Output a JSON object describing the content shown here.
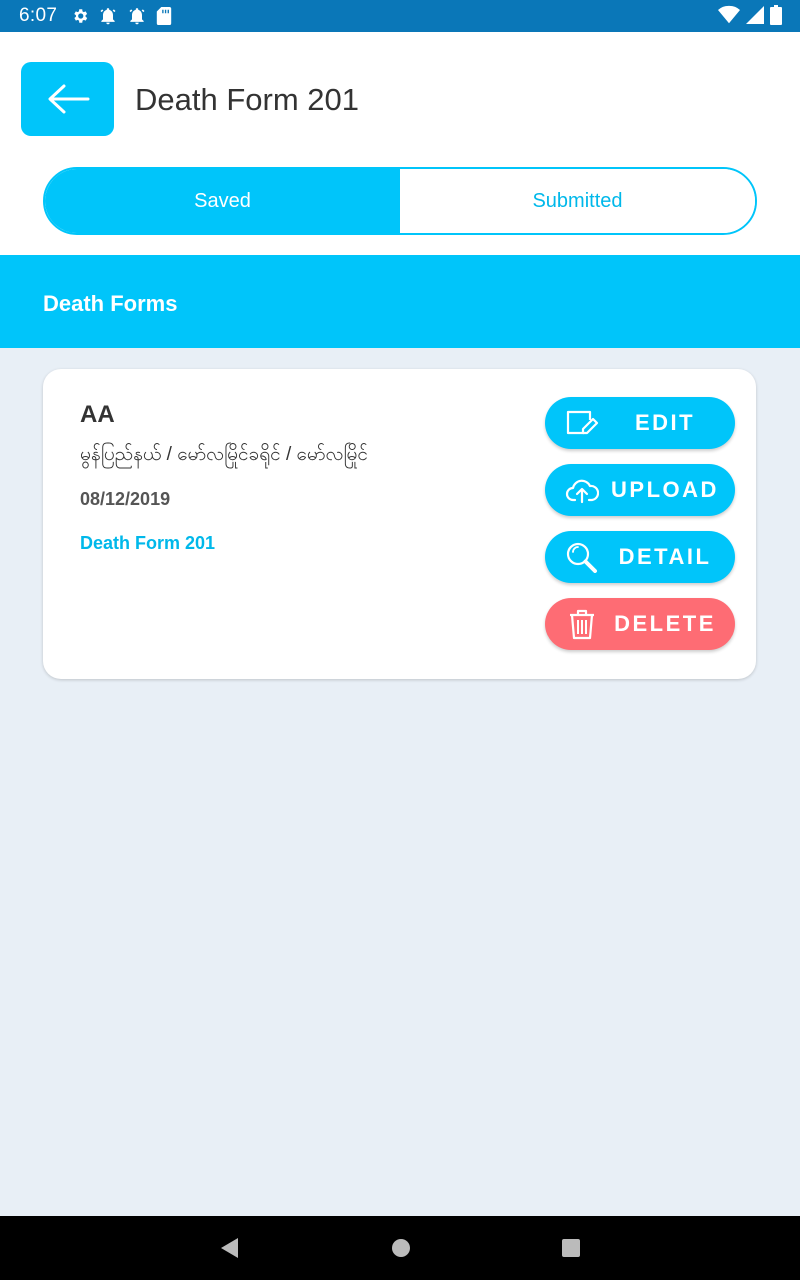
{
  "status_bar": {
    "time": "6:07",
    "left_icons": [
      "gear-icon",
      "alarm-icon",
      "alarm-icon",
      "sd-card-icon"
    ],
    "right_icons": [
      "wifi-icon",
      "signal-icon",
      "battery-icon"
    ]
  },
  "app_bar": {
    "back_icon": "arrow-left-icon",
    "title": "Death Form 201"
  },
  "tabs": [
    {
      "label": "Saved",
      "active": true
    },
    {
      "label": "Submitted",
      "active": false
    }
  ],
  "section": {
    "title": "Death Forms"
  },
  "records": [
    {
      "name": "AA",
      "address": "မွန်ပြည်နယ် / မော်လမြိုင်ခရိုင် / မော်လမြိုင်",
      "date": "08/12/2019",
      "form": "Death Form 201",
      "actions": {
        "edit": "EDIT",
        "upload": "UPLOAD",
        "detail": "DETAIL",
        "delete": "DELETE"
      }
    }
  ],
  "colors": {
    "status_bar": "#0a77b8",
    "accent": "#00c5fa",
    "danger": "#fe6c74",
    "background": "#e8eff6"
  },
  "nav_bar": {
    "icons": [
      "back-triangle-icon",
      "home-circle-icon",
      "recents-square-icon"
    ]
  }
}
